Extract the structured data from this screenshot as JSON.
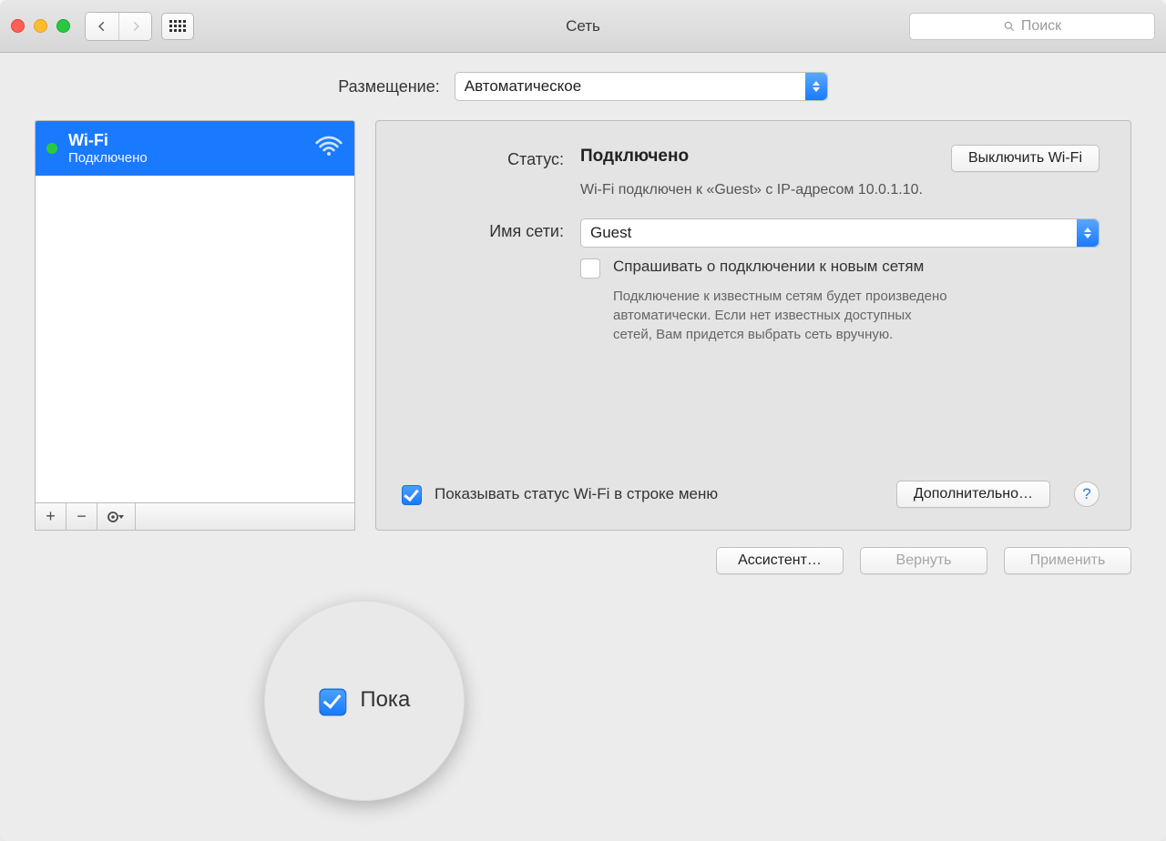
{
  "window": {
    "title": "Сеть"
  },
  "search": {
    "placeholder": "Поиск"
  },
  "location": {
    "label": "Размещение:",
    "value": "Автоматическое"
  },
  "sidebar": {
    "items": [
      {
        "name": "Wi-Fi",
        "status": "Подключено"
      }
    ]
  },
  "detail": {
    "status_label": "Статус:",
    "status_value": "Подключено",
    "status_desc": "Wi-Fi подключен к «Guest» с IP-адресом 10.0.1.10.",
    "turn_off_label": "Выключить Wi-Fi",
    "network_label": "Имя сети:",
    "network_value": "Guest",
    "ask_label": "Спрашивать о подключении к новым сетям",
    "ask_desc": "Подключение к известным сетям будет произведено автоматически. Если нет известных доступных сетей, Вам придется выбрать сеть вручную.",
    "show_status_label": "Показывать статус Wi-Fi в строке меню",
    "advanced_label": "Дополнительно…",
    "magnifier_text": "Пока"
  },
  "footer": {
    "assistant": "Ассистент…",
    "revert": "Вернуть",
    "apply": "Применить"
  }
}
